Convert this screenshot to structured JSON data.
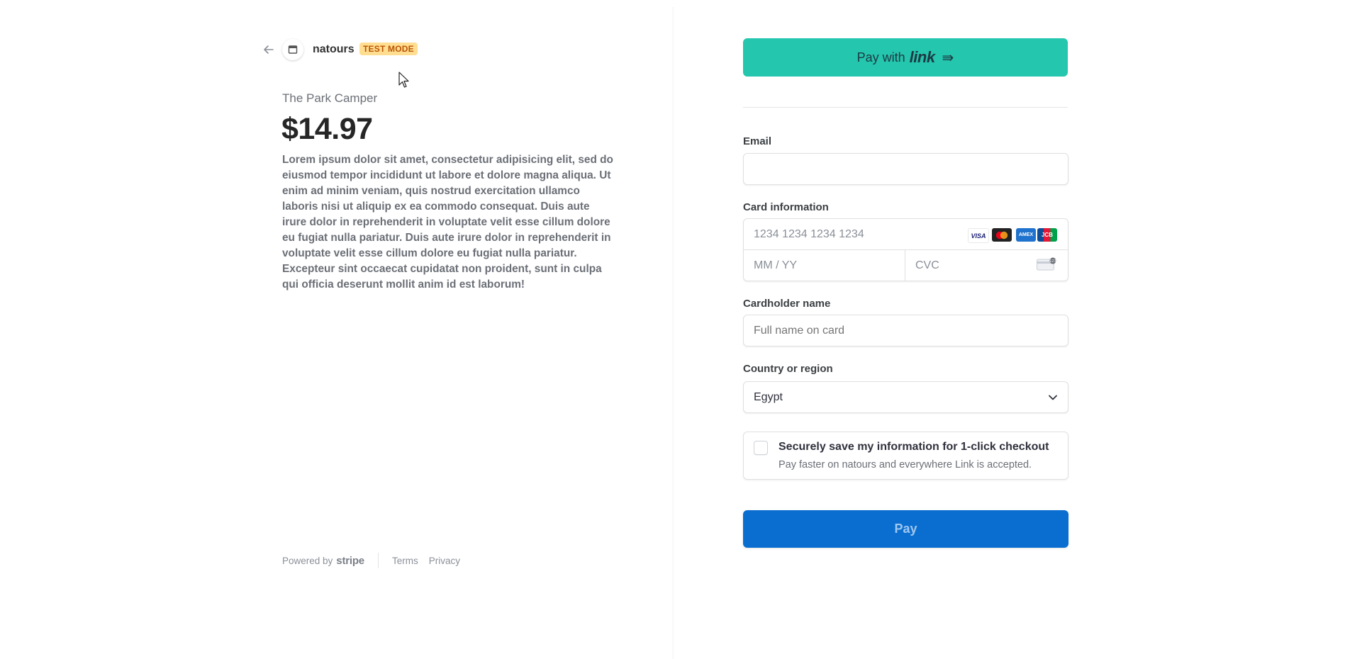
{
  "merchant": {
    "name": "natours",
    "badge": "TEST MODE"
  },
  "product": {
    "name": "The Park Camper",
    "price": "$14.97",
    "description": "Lorem ipsum dolor sit amet, consectetur adipisicing elit, sed do eiusmod tempor incididunt ut labore et dolore magna aliqua. Ut enim ad minim veniam, quis nostrud exercitation ullamco laboris nisi ut aliquip ex ea commodo consequat. Duis aute irure dolor in reprehenderit in voluptate velit esse cillum dolore eu fugiat nulla pariatur. Duis aute irure dolor in reprehenderit in voluptate velit esse cillum dolore eu fugiat nulla pariatur. Excepteur sint occaecat cupidatat non proident, sunt in culpa qui officia deserunt mollit anim id est laborum!"
  },
  "footer": {
    "powered_by": "Powered by",
    "brand": "stripe",
    "terms": "Terms",
    "privacy": "Privacy"
  },
  "link_button": {
    "prefix": "Pay with",
    "brand": "link",
    "arrow": "⇛"
  },
  "form": {
    "email": {
      "label": "Email",
      "value": ""
    },
    "card": {
      "label": "Card information",
      "number_placeholder": "1234 1234 1234 1234",
      "expiry_placeholder": "MM / YY",
      "cvc_placeholder": "CVC",
      "brands": [
        "VISA",
        "Mastercard",
        "Amex",
        "JCB"
      ]
    },
    "cardholder": {
      "label": "Cardholder name",
      "placeholder": "Full name on card"
    },
    "country": {
      "label": "Country or region",
      "value": "Egypt"
    },
    "save": {
      "title": "Securely save my information for 1-click checkout",
      "subtitle": "Pay faster on natours and everywhere Link is accepted.",
      "checked": false
    },
    "pay_label": "Pay"
  },
  "colors": {
    "link_green": "#24c6ad",
    "pay_blue": "#0a6ed1",
    "badge_bg": "#ffde92",
    "badge_text": "#bb5504"
  }
}
